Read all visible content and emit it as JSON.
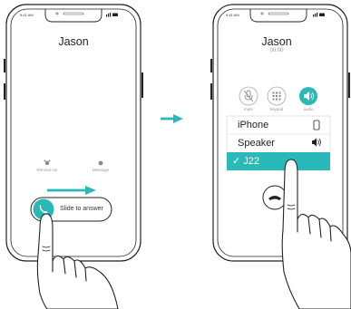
{
  "left_phone": {
    "status_time": "9:41 AM",
    "caller_name": "Jason",
    "remind_label": "Remind me",
    "message_label": "Message",
    "slide_label": "Slide to answer"
  },
  "right_phone": {
    "status_time": "9:41 AM",
    "caller_name": "Jason",
    "call_timer": "00:00",
    "controls": [
      {
        "label": "mute",
        "icon": "mic-off-icon"
      },
      {
        "label": "keypad",
        "icon": "keypad-icon"
      },
      {
        "label": "audio",
        "icon": "speaker-icon"
      }
    ],
    "audio_menu": [
      {
        "label": "iPhone",
        "icon": "phone-icon",
        "selected": false
      },
      {
        "label": "Speaker",
        "icon": "speaker-icon",
        "selected": false
      },
      {
        "label": "✓ J22",
        "icon": "",
        "selected": true
      }
    ]
  },
  "colors": {
    "accent": "#2bb8b8",
    "outline": "#222222"
  }
}
